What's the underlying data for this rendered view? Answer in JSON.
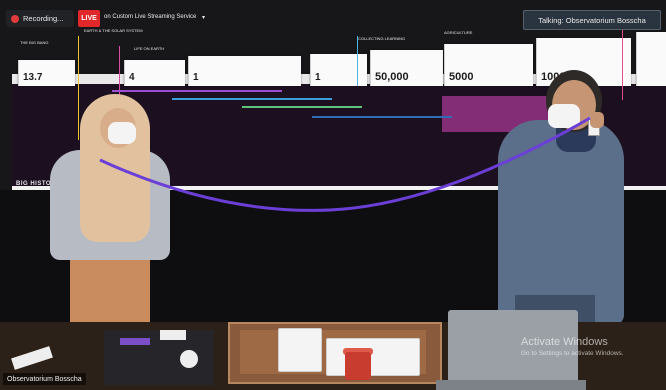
{
  "zoom_ui": {
    "recording_label": "Recording...",
    "live_badge": "LIVE",
    "live_service": "on Custom Live Streaming Service",
    "talking_label": "Talking: Observatorium Bosscha",
    "participant_name": "Observatorium Bosscha",
    "activate_title": "Activate Windows",
    "activate_subtitle": "Go to Settings to activate Windows."
  },
  "timeline": {
    "card_numbers": [
      "13.7",
      "4",
      "1",
      "1",
      "50,000",
      "5000",
      "1000"
    ],
    "section_labels": {
      "big_history": "BIG HISTORY",
      "collecting": "COLLECTING LEARNING",
      "agriculture": "AGRICULTURE",
      "life_on_earth": "LIFE ON EARTH",
      "earth_solar": "EARTH & THE SOLAR SYSTEM",
      "big_bang": "THE BIG BANG"
    }
  },
  "colors": {
    "live_red": "#e0282a",
    "record_red": "#e23b3b",
    "talking_bg": "#2a3440",
    "rope_purple": "#6b3fd6"
  },
  "icons": [
    "record-dot-icon",
    "dropdown-caret-icon"
  ]
}
